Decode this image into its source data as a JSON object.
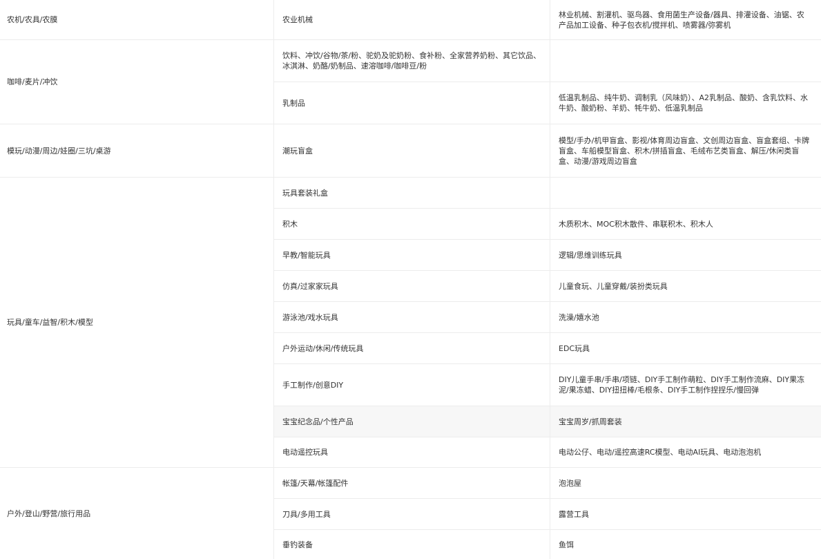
{
  "rows": [
    {
      "category": "农机/农具/农膜",
      "items": [
        {
          "sub": "农业机械",
          "detail": "林业机械、割灌机、驱鸟器、食用菌生产设备/器具、排灌设备、油锯、农产品加工设备、种子包衣机/搅拌机、喷雾器/弥雾机"
        }
      ]
    },
    {
      "category": "咖啡/麦片/冲饮",
      "items": [
        {
          "sub": "饮料、冲饮/谷物/茶/粉、驼奶及驼奶粉、食补粉、全家营养奶粉、其它饮品、冰淇淋、奶酪/奶制品、速溶咖啡/咖啡豆/粉",
          "detail": ""
        },
        {
          "sub": "乳制品",
          "detail": "低温乳制品、纯牛奶、调制乳（风味奶）、A2乳制品、酸奶、含乳饮料、水牛奶、酸奶粉、羊奶、牦牛奶、低温乳制品"
        }
      ]
    },
    {
      "category": "模玩/动漫/周边/娃圈/三坑/桌游",
      "items": [
        {
          "sub": "潮玩盲盒",
          "detail": "模型/手办/机甲盲盒、影视/体育周边盲盒、文创周边盲盒、盲盒套组、卡牌盲盒、车船模型盲盒、积木/拼插盲盒、毛绒布艺类盲盒、解压/休闲类盲盒、动漫/游戏周边盲盒"
        }
      ]
    },
    {
      "category": "玩具/童车/益智/积木/模型",
      "items": [
        {
          "sub": "玩具套装礼盒",
          "detail": ""
        },
        {
          "sub": "积木",
          "detail": "木质积木、MOC积木散件、串联积木、积木人"
        },
        {
          "sub": "早教/智能玩具",
          "detail": "逻辑/思维训练玩具"
        },
        {
          "sub": "仿真/过家家玩具",
          "detail": "儿童食玩、儿童穿戴/装扮类玩具"
        },
        {
          "sub": "游泳池/戏水玩具",
          "detail": "洗澡/嬉水池"
        },
        {
          "sub": "户外运动/休闲/传统玩具",
          "detail": "EDC玩具"
        },
        {
          "sub": "手工制作/创意DIY",
          "detail": "DIY儿童手串/手串/项链、DIY手工制作萌粒、DIY手工制作流麻、DIY果冻泥/果冻蜡、DIY扭扭棒/毛根条、DIY手工制作捏捏乐/慢回弹"
        },
        {
          "sub": "宝宝纪念品/个性产品",
          "detail": "宝宝周岁/抓周套装"
        },
        {
          "sub": "电动遥控玩具",
          "detail": "电动公仔、电动/遥控高速RC模型、电动AI玩具、电动泡泡机"
        }
      ]
    },
    {
      "category": "户外/登山/野营/旅行用品",
      "items": [
        {
          "sub": "帐篷/天幕/帐篷配件",
          "detail": "泡泡屋"
        },
        {
          "sub": "刀具/多用工具",
          "detail": "露营工具"
        },
        {
          "sub": "垂钓装备",
          "detail": "鱼饵"
        }
      ]
    }
  ]
}
